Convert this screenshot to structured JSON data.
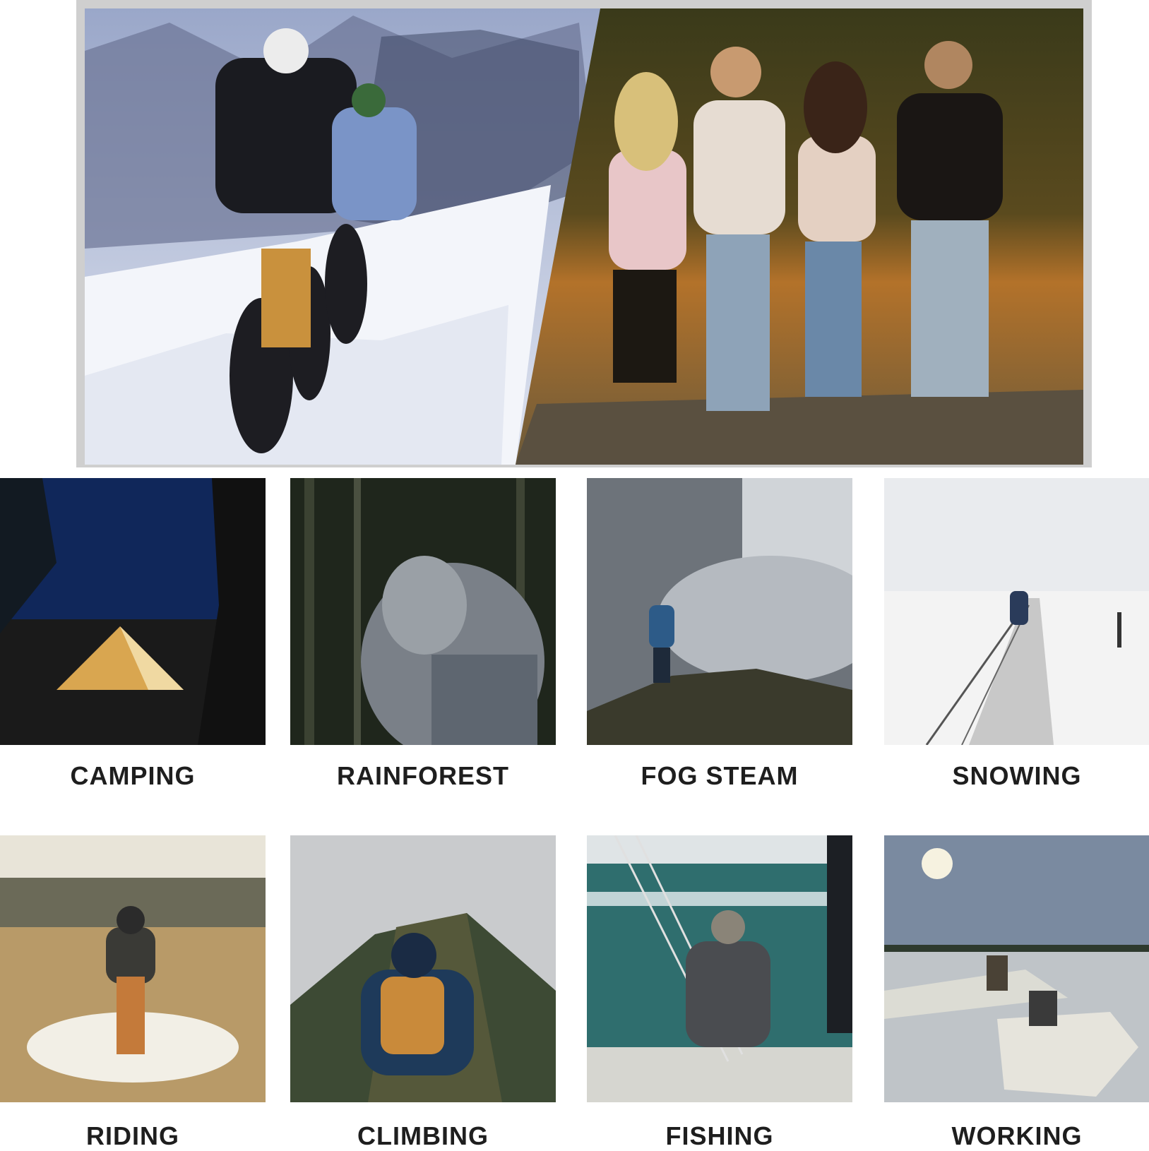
{
  "hero": {
    "left_scene": "snow-biking",
    "right_scene": "autumn-walk"
  },
  "activities": [
    {
      "label": "CAMPING",
      "scene": "tent-night"
    },
    {
      "label": "RAINFOREST",
      "scene": "hiker-forest"
    },
    {
      "label": "FOG STEAM",
      "scene": "waterfall-fog"
    },
    {
      "label": "SNOWING",
      "scene": "snowy-road"
    },
    {
      "label": "RIDING",
      "scene": "motorbike-field"
    },
    {
      "label": "CLIMBING",
      "scene": "mountain-ridge"
    },
    {
      "label": "FISHING",
      "scene": "pier-fishing"
    },
    {
      "label": "WORKING",
      "scene": "lake-boats"
    }
  ]
}
